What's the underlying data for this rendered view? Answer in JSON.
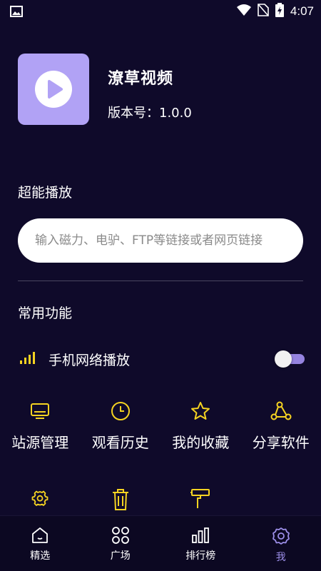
{
  "status_bar": {
    "time": "4:07"
  },
  "app": {
    "name": "潦草视频",
    "version": "版本号：1.0.0"
  },
  "play_section": {
    "title": "超能播放",
    "search_placeholder": "输入磁力、电驴、FTP等链接或者网页链接"
  },
  "common_section": {
    "title": "常用功能",
    "mobile_network_label": "手机网络播放",
    "mobile_network_enabled": true
  },
  "features_row1": [
    {
      "label": "站源管理",
      "icon": "monitor-icon"
    },
    {
      "label": "观看历史",
      "icon": "clock-icon"
    },
    {
      "label": "我的收藏",
      "icon": "star-icon"
    },
    {
      "label": "分享软件",
      "icon": "share-icon"
    }
  ],
  "features_row2": [
    {
      "icon": "gear-icon"
    },
    {
      "icon": "trash-icon"
    },
    {
      "icon": "paint-roller-icon"
    }
  ],
  "bottom_nav": [
    {
      "label": "精选",
      "icon": "home-icon",
      "active": false
    },
    {
      "label": "广场",
      "icon": "grid-icon",
      "active": false
    },
    {
      "label": "排行榜",
      "icon": "bar-chart-icon",
      "active": false
    },
    {
      "label": "我",
      "icon": "gear-icon",
      "active": true
    }
  ],
  "colors": {
    "background": "#0f0a2a",
    "accent": "#9c8ee8",
    "icon_yellow": "#f5d321",
    "logo_bg": "#b1a2f5"
  }
}
